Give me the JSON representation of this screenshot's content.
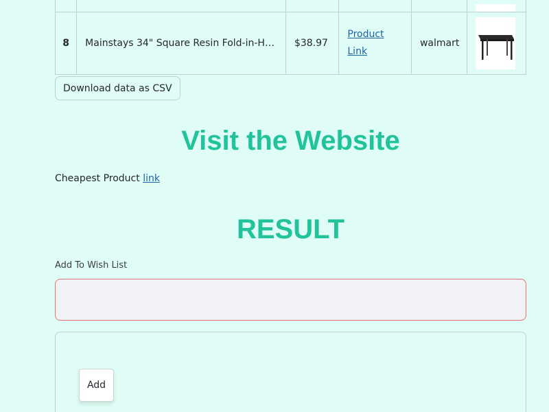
{
  "table": {
    "rows": [
      {
        "index": "",
        "name": "",
        "price": "",
        "link_label": "",
        "site": ""
      },
      {
        "index": "8",
        "name": "Mainstays 34\" Square Resin Fold-in-Half ...",
        "price": "$38.97",
        "link_label": "Product Link",
        "site": "walmart",
        "image_icon": "folding-table-icon"
      }
    ]
  },
  "download_button": "Download data as CSV",
  "visit_heading": "Visit the Website",
  "cheapest": {
    "prefix": "Cheapest Product",
    "link_label": "link"
  },
  "result_heading": "RESULT",
  "wish_list": {
    "label": "Add To Wish List",
    "value": ""
  },
  "add_button": "Add",
  "colors": {
    "background": "#dffdf6",
    "heading": "#22c39b",
    "link": "#1f63a3",
    "input_border_error": "#e57373"
  }
}
